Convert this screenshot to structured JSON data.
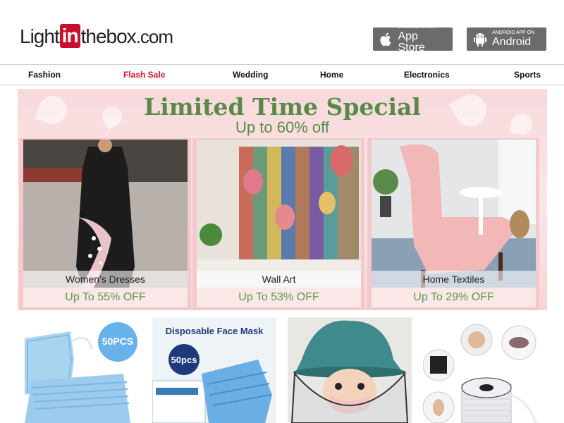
{
  "logo": {
    "part1": "Light",
    "part2": "in",
    "part3": "thebox",
    "part4": ".com"
  },
  "store": {
    "appstore_small": "Download on the",
    "appstore_big": "App Store",
    "android_small": "ANDROID APP ON",
    "android_big": "Android"
  },
  "nav": [
    "Fashion",
    "Flash Sale",
    "Wedding",
    "Home",
    "Electronics",
    "Sports"
  ],
  "banner": {
    "title": "Limited Time Special",
    "subtitle": "Up to 60% off",
    "cards": [
      {
        "label": "Women's Dresses",
        "off": "Up To 55% OFF"
      },
      {
        "label": "Wall Art",
        "off": "Up To 53% OFF"
      },
      {
        "label": "Home Textiles",
        "off": "Up To 29% OFF"
      }
    ]
  },
  "products": {
    "p1_badge": "50PCS",
    "p2_title": "Disposable Face Mask",
    "p2_badge": "50pcs"
  },
  "colors": {
    "flash_sale": "#e0112b",
    "banner_green": "#5a8a47",
    "logo_red": "#c8102e"
  }
}
